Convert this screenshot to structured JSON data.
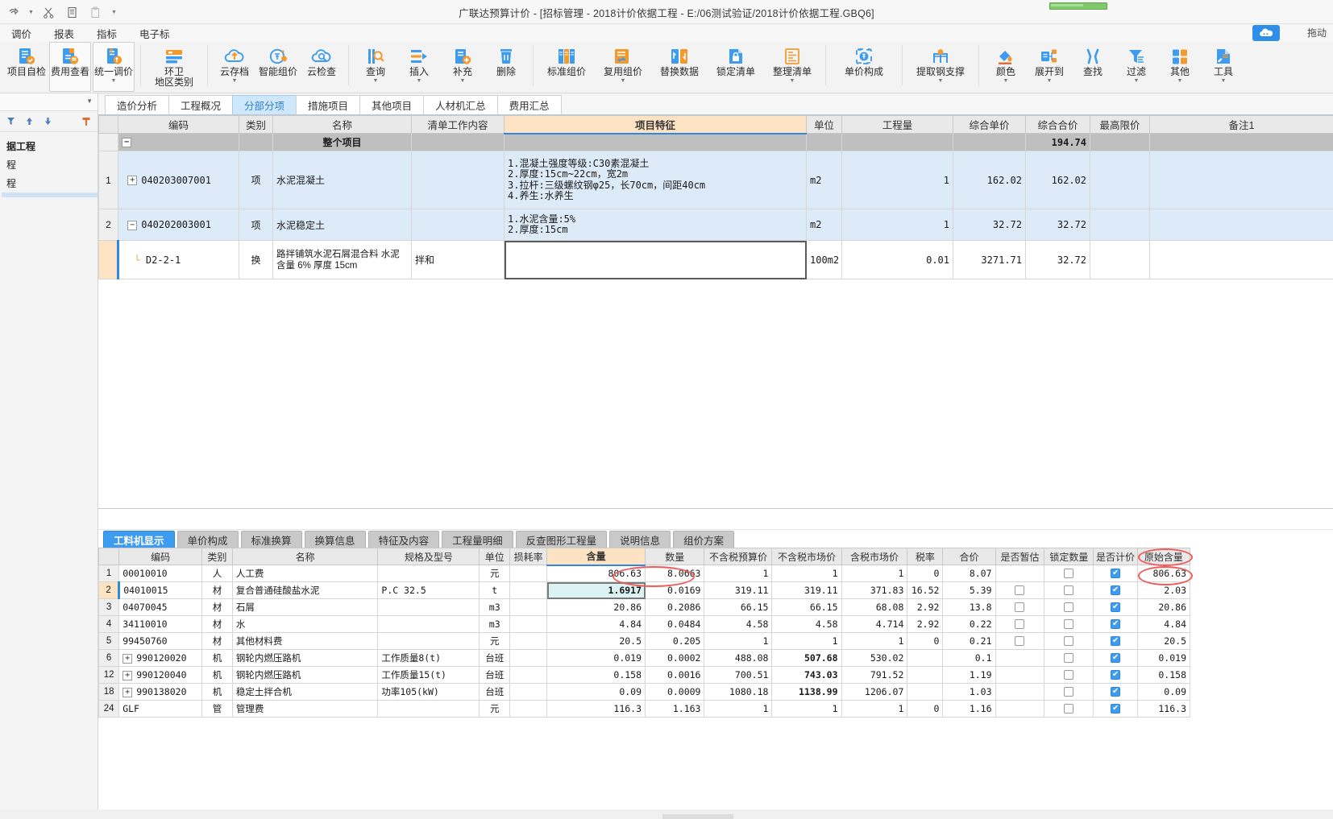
{
  "window": {
    "title": "广联达预算计价 - [招标管理 - 2018计价依据工程 - E:/06测试验证/2018计价依据工程.GBQ6]",
    "quick_access": [
      "undo-icon",
      "caret-down-icon",
      "cut-icon",
      "copy-icon",
      "paste-icon",
      "caret-down-icon"
    ],
    "cloud_badge": "co",
    "drag_hint": "拖动"
  },
  "menubar": {
    "items": [
      "调价",
      "报表",
      "指标",
      "电子标"
    ]
  },
  "ribbon": {
    "buttons": [
      {
        "label": "项目自检",
        "label2": "",
        "icon": "self-check-icon",
        "dropdown": false,
        "boxed": false
      },
      {
        "label": "费用查看",
        "label2": "",
        "icon": "cost-view-icon",
        "dropdown": false,
        "boxed": true
      },
      {
        "label": "统一调价",
        "label2": "",
        "icon": "unified-price-icon",
        "dropdown": true,
        "boxed": true
      },
      {
        "label": "环卫",
        "label2": "地区类别",
        "icon": "sanitation-icon",
        "dropdown": false,
        "boxed": false
      },
      {
        "label": "云存档",
        "label2": "",
        "icon": "cloud-archive-icon",
        "dropdown": true,
        "boxed": false
      },
      {
        "label": "智能组价",
        "label2": "",
        "icon": "smart-price-icon",
        "dropdown": false,
        "boxed": false
      },
      {
        "label": "云检查",
        "label2": "",
        "icon": "cloud-check-icon",
        "dropdown": false,
        "boxed": false
      },
      {
        "label": "查询",
        "label2": "",
        "icon": "query-icon",
        "dropdown": true,
        "boxed": false
      },
      {
        "label": "插入",
        "label2": "",
        "icon": "insert-icon",
        "dropdown": true,
        "boxed": false
      },
      {
        "label": "补充",
        "label2": "",
        "icon": "supplement-icon",
        "dropdown": true,
        "boxed": false
      },
      {
        "label": "删除",
        "label2": "",
        "icon": "delete-icon",
        "dropdown": false,
        "boxed": false
      },
      {
        "label": "标准组价",
        "label2": "",
        "icon": "standard-price-icon",
        "dropdown": false,
        "boxed": false
      },
      {
        "label": "复用组价",
        "label2": "",
        "icon": "reuse-price-icon",
        "dropdown": true,
        "boxed": false
      },
      {
        "label": "替换数据",
        "label2": "",
        "icon": "replace-data-icon",
        "dropdown": false,
        "boxed": false
      },
      {
        "label": "锁定清单",
        "label2": "",
        "icon": "lock-list-icon",
        "dropdown": false,
        "boxed": false
      },
      {
        "label": "整理清单",
        "label2": "",
        "icon": "organize-list-icon",
        "dropdown": true,
        "boxed": false
      },
      {
        "label": "单价构成",
        "label2": "",
        "icon": "unit-price-composition-icon",
        "dropdown": false,
        "boxed": false
      },
      {
        "label": "提取钢支撑",
        "label2": "",
        "icon": "extract-steel-support-icon",
        "dropdown": true,
        "boxed": false
      },
      {
        "label": "颜色",
        "label2": "",
        "icon": "color-icon",
        "dropdown": true,
        "boxed": false
      },
      {
        "label": "展开到",
        "label2": "",
        "icon": "expand-to-icon",
        "dropdown": true,
        "boxed": false
      },
      {
        "label": "查找",
        "label2": "",
        "icon": "find-icon",
        "dropdown": false,
        "boxed": false
      },
      {
        "label": "过滤",
        "label2": "",
        "icon": "filter-icon",
        "dropdown": true,
        "boxed": false
      },
      {
        "label": "其他",
        "label2": "",
        "icon": "other-icon",
        "dropdown": true,
        "boxed": false
      },
      {
        "label": "工具",
        "label2": "",
        "icon": "tools-icon",
        "dropdown": true,
        "boxed": false
      }
    ]
  },
  "sidebar": {
    "tools": [
      "filter-icon",
      "arrow-up-icon",
      "arrow-down-icon",
      "pin-icon"
    ],
    "items": [
      {
        "label": "据工程",
        "bold": true,
        "selected": false
      },
      {
        "label": "程",
        "bold": false,
        "selected": false
      },
      {
        "label": "程",
        "bold": false,
        "selected": false
      },
      {
        "label": "",
        "bold": false,
        "selected": true
      }
    ]
  },
  "upper": {
    "tabs": [
      {
        "label": "造价分析",
        "active": false
      },
      {
        "label": "工程概况",
        "active": false
      },
      {
        "label": "分部分项",
        "active": true
      },
      {
        "label": "措施项目",
        "active": false
      },
      {
        "label": "其他项目",
        "active": false
      },
      {
        "label": "人材机汇总",
        "active": false
      },
      {
        "label": "费用汇总",
        "active": false
      }
    ],
    "columns": [
      "",
      "编码",
      "类别",
      "名称",
      "清单工作内容",
      "项目特征",
      "单位",
      "工程量",
      "综合单价",
      "综合合价",
      "最高限价",
      "备注1"
    ],
    "highlight_column": "项目特征",
    "rows": [
      {
        "kind": "group",
        "rownum": "",
        "expander": "minus",
        "code": "",
        "category": "",
        "name": "整个项目",
        "work_content": "",
        "features": "",
        "unit": "",
        "quantity": "",
        "unit_price": "",
        "total_price": "194.74",
        "max_price": "",
        "remark": ""
      },
      {
        "kind": "item",
        "rownum": "1",
        "expander": "plus",
        "code": "040203007001",
        "category": "项",
        "name": "水泥混凝土",
        "work_content": "",
        "features": "1.混凝土强度等级:C30素混凝土\n2.厚度:15cm~22cm，宽2m\n3.拉杆:三级螺纹钢φ25，长70cm，间距40cm\n4.养生:水养生",
        "unit": "m2",
        "quantity": "1",
        "unit_price": "162.02",
        "total_price": "162.02",
        "max_price": "",
        "remark": ""
      },
      {
        "kind": "item",
        "rownum": "2",
        "expander": "minus",
        "code": "040202003001",
        "category": "项",
        "name": "水泥稳定土",
        "work_content": "",
        "features": "1.水泥含量:5%\n2.厚度:15cm",
        "unit": "m2",
        "quantity": "1",
        "unit_price": "32.72",
        "total_price": "32.72",
        "max_price": "",
        "remark": ""
      },
      {
        "kind": "sub",
        "rownum": "",
        "expander": "none",
        "code": "D2-2-1",
        "category": "换",
        "name": "路拌铺筑水泥石屑混合料 水泥含量 6% 厚度 15cm",
        "work_content": "拌和",
        "features": "",
        "unit": "100m2",
        "quantity": "0.01",
        "unit_price": "3271.71",
        "total_price": "32.72",
        "max_price": "",
        "remark": ""
      }
    ]
  },
  "lower": {
    "tabs": [
      {
        "label": "工料机显示",
        "active": true
      },
      {
        "label": "单价构成",
        "active": false
      },
      {
        "label": "标准换算",
        "active": false
      },
      {
        "label": "换算信息",
        "active": false
      },
      {
        "label": "特征及内容",
        "active": false
      },
      {
        "label": "工程量明细",
        "active": false
      },
      {
        "label": "反查图形工程量",
        "active": false
      },
      {
        "label": "说明信息",
        "active": false
      },
      {
        "label": "组价方案",
        "active": false
      }
    ],
    "columns": [
      "",
      "编码",
      "类别",
      "名称",
      "规格及型号",
      "单位",
      "损耗率",
      "含量",
      "数量",
      "不含税预算价",
      "不含税市场价",
      "含税市场价",
      "税率",
      "合价",
      "是否暂估",
      "锁定数量",
      "是否计价",
      "原始含量"
    ],
    "highlight_column": "含量",
    "rows": [
      {
        "rownum": "1",
        "expander": "none",
        "code": "00010010",
        "category": "人",
        "name": "人工费",
        "spec": "",
        "unit": "元",
        "loss": "",
        "content": "806.63",
        "content_style": "normal",
        "quantity": "8.0663",
        "budget_price": "1",
        "market_price_ex": "1",
        "market_price_ex_style": "normal",
        "market_price_in": "1",
        "tax_rate": "0",
        "total": "8.07",
        "provisional": false,
        "provisional_show": false,
        "lock_qty": false,
        "counted": true,
        "orig_content": "806.63",
        "selected": false
      },
      {
        "rownum": "2",
        "expander": "none",
        "code": "04010015",
        "category": "材",
        "name": "复合普通硅酸盐水泥",
        "spec": "P.C 32.5",
        "unit": "t",
        "loss": "",
        "content": "1.6917",
        "content_style": "red-editing",
        "quantity": "0.0169",
        "budget_price": "319.11",
        "market_price_ex": "319.11",
        "market_price_ex_style": "normal",
        "market_price_in": "371.83",
        "tax_rate": "16.52",
        "total": "5.39",
        "provisional": false,
        "provisional_show": true,
        "lock_qty": false,
        "counted": true,
        "orig_content": "2.03",
        "selected": true
      },
      {
        "rownum": "3",
        "expander": "none",
        "code": "04070045",
        "category": "材",
        "name": "石屑",
        "spec": "",
        "unit": "m3",
        "loss": "",
        "content": "20.86",
        "content_style": "normal",
        "quantity": "0.2086",
        "budget_price": "66.15",
        "market_price_ex": "66.15",
        "market_price_ex_style": "normal",
        "market_price_in": "68.08",
        "tax_rate": "2.92",
        "total": "13.8",
        "provisional": false,
        "provisional_show": true,
        "lock_qty": false,
        "counted": true,
        "orig_content": "20.86",
        "selected": false
      },
      {
        "rownum": "4",
        "expander": "none",
        "code": "34110010",
        "category": "材",
        "name": "水",
        "spec": "",
        "unit": "m3",
        "loss": "",
        "content": "4.84",
        "content_style": "normal",
        "quantity": "0.0484",
        "budget_price": "4.58",
        "market_price_ex": "4.58",
        "market_price_ex_style": "normal",
        "market_price_in": "4.714",
        "tax_rate": "2.92",
        "total": "0.22",
        "provisional": false,
        "provisional_show": true,
        "lock_qty": false,
        "counted": true,
        "orig_content": "4.84",
        "selected": false
      },
      {
        "rownum": "5",
        "expander": "none",
        "code": "99450760",
        "category": "材",
        "name": "其他材料费",
        "spec": "",
        "unit": "元",
        "loss": "",
        "content": "20.5",
        "content_style": "normal",
        "quantity": "0.205",
        "budget_price": "1",
        "market_price_ex": "1",
        "market_price_ex_style": "normal",
        "market_price_in": "1",
        "tax_rate": "0",
        "total": "0.21",
        "provisional": false,
        "provisional_show": true,
        "lock_qty": false,
        "counted": true,
        "orig_content": "20.5",
        "selected": false
      },
      {
        "rownum": "6",
        "expander": "plus",
        "code": "990120020",
        "category": "机",
        "name": "钢轮内燃压路机",
        "spec": "工作质量8(t)",
        "unit": "台班",
        "loss": "",
        "content": "0.019",
        "content_style": "normal",
        "quantity": "0.0002",
        "budget_price": "488.08",
        "market_price_ex": "507.68",
        "market_price_ex_style": "blue",
        "market_price_in": "530.02",
        "tax_rate": "",
        "total": "0.1",
        "provisional": false,
        "provisional_show": false,
        "lock_qty": false,
        "counted": true,
        "orig_content": "0.019",
        "selected": false
      },
      {
        "rownum": "12",
        "expander": "plus",
        "code": "990120040",
        "category": "机",
        "name": "钢轮内燃压路机",
        "spec": "工作质量15(t)",
        "unit": "台班",
        "loss": "",
        "content": "0.158",
        "content_style": "normal",
        "quantity": "0.0016",
        "budget_price": "700.51",
        "market_price_ex": "743.03",
        "market_price_ex_style": "blue",
        "market_price_in": "791.52",
        "tax_rate": "",
        "total": "1.19",
        "provisional": false,
        "provisional_show": false,
        "lock_qty": false,
        "counted": true,
        "orig_content": "0.158",
        "selected": false
      },
      {
        "rownum": "18",
        "expander": "plus",
        "code": "990138020",
        "category": "机",
        "name": "稳定土拌合机",
        "spec": "功率105(kW)",
        "unit": "台班",
        "loss": "",
        "content": "0.09",
        "content_style": "normal",
        "quantity": "0.0009",
        "budget_price": "1080.18",
        "market_price_ex": "1138.99",
        "market_price_ex_style": "blue",
        "market_price_in": "1206.07",
        "tax_rate": "",
        "total": "1.03",
        "provisional": false,
        "provisional_show": false,
        "lock_qty": false,
        "counted": true,
        "orig_content": "0.09",
        "selected": false
      },
      {
        "rownum": "24",
        "expander": "none",
        "code": "GLF",
        "category": "管",
        "name": "管理费",
        "spec": "",
        "unit": "元",
        "loss": "",
        "content": "116.3",
        "content_style": "normal",
        "quantity": "1.163",
        "budget_price": "1",
        "market_price_ex": "1",
        "market_price_ex_style": "normal",
        "market_price_in": "1",
        "tax_rate": "0",
        "total": "1.16",
        "provisional": false,
        "provisional_show": false,
        "lock_qty": false,
        "counted": true,
        "orig_content": "116.3",
        "selected": false
      }
    ]
  },
  "colors": {
    "accent": "#3d9bf0",
    "highlight_header": "#fde3c4",
    "selected_row_upper": "#ddeaf8",
    "annotation": "#ef5a5a",
    "blue_value": "#1032c8",
    "red_value": "#e02020"
  }
}
